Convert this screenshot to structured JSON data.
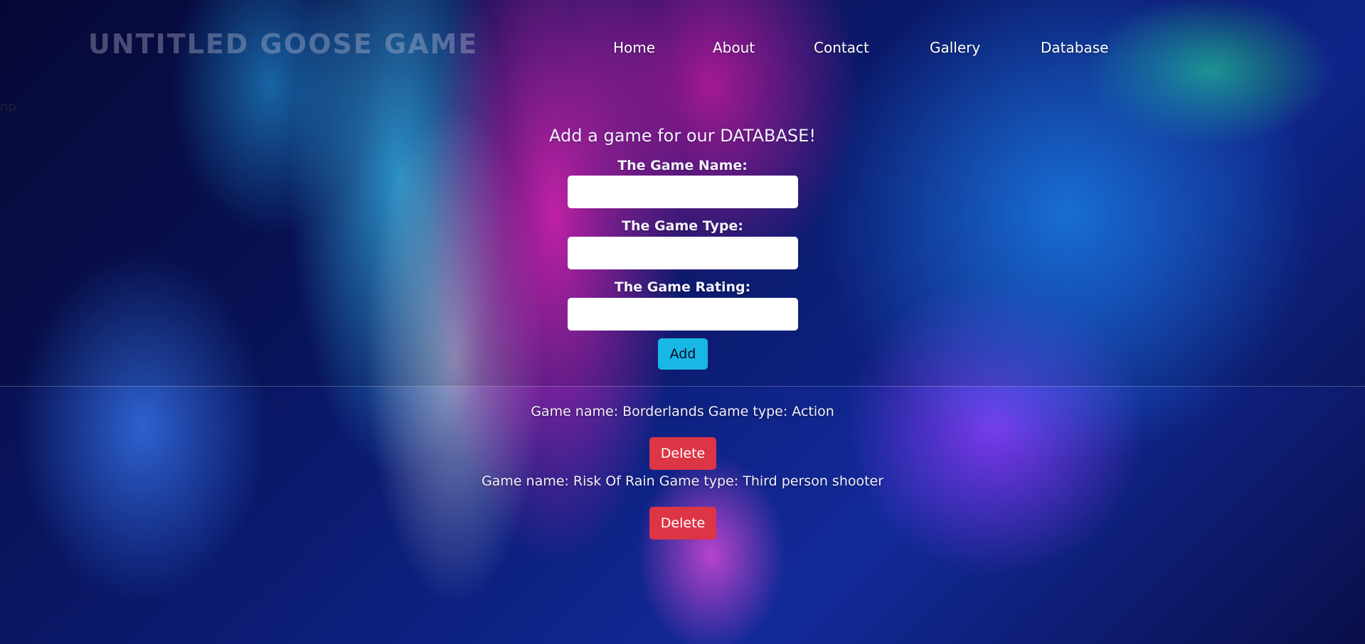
{
  "header": {
    "site_title": "UNTITLED GOOSE GAME",
    "stray_text": "np"
  },
  "nav": {
    "items": [
      {
        "label": "Home"
      },
      {
        "label": "About"
      },
      {
        "label": "Contact"
      },
      {
        "label": "Gallery"
      },
      {
        "label": "Database"
      }
    ]
  },
  "form": {
    "heading": "Add a game for our DATABASE!",
    "name_label": "The Game Name:",
    "name_value": "",
    "type_label": "The Game Type:",
    "type_value": "",
    "rating_label": "The Game Rating:",
    "rating_value": "",
    "add_label": "Add"
  },
  "games": [
    {
      "text": "Game name: Borderlands Game type: Action",
      "delete_label": "Delete"
    },
    {
      "text": "Game name: Risk Of Rain Game type: Third person shooter",
      "delete_label": "Delete"
    }
  ],
  "colors": {
    "add_button": "#17b8e6",
    "delete_button": "#dc3545"
  }
}
